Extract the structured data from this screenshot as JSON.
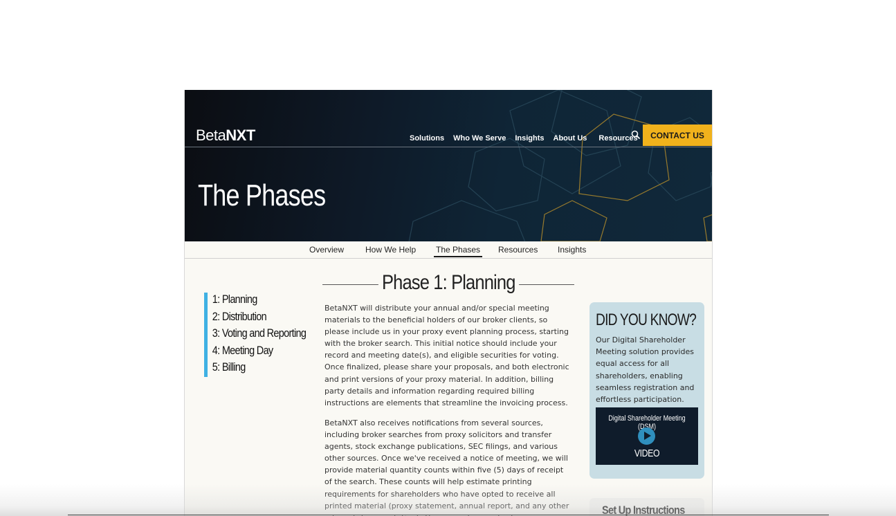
{
  "header": {
    "logo_light": "Beta",
    "logo_bold": "NXT",
    "nav": [
      "Solutions",
      "Who We Serve",
      "Insights",
      "About Us",
      "Resources"
    ],
    "search_icon": "search-icon",
    "contact_label": "CONTACT US",
    "colors": {
      "contact_bg": "#f1b21c",
      "hero_bg": "#0f2536",
      "accent_line": "#3fb1e3"
    }
  },
  "hero": {
    "title": "The Phases"
  },
  "subnav": {
    "items": [
      "Overview",
      "How We Help",
      "The Phases",
      "Resources",
      "Insights"
    ],
    "active": "The Phases"
  },
  "sidebar": {
    "items": [
      "1: Planning",
      "2: Distribution",
      "3: Voting and Reporting",
      "4: Meeting Day",
      "5: Billing"
    ]
  },
  "main": {
    "heading": "Phase 1: Planning",
    "paragraph1": "BetaNXT will distribute your annual and/or special meeting materials to the beneficial holders of our broker clients, so please include us in your proxy event planning process, starting with the broker search. This initial notice should include your record and meeting date(s), and eligible securities for voting. Once finalized, please share your proposals, and both electronic and print versions of your proxy material. In addition, billing party details and information regarding required billing instructions are elements that streamline the invoicing process.",
    "paragraph2": "BetaNXT also receives notifications from several sources, including broker searches from proxy solicitors and transfer agents, stock exchange publications, SEC filings, and various other sources. Once we've received a notice of meeting, we will provide material quantity counts within five (5) days of receipt of the search. These counts will help estimate printing requirements for shareholders who have opted to receive all printed material (proxy statement, annual report, and any other relevant documentation). These counts can also be"
  },
  "did_you_know": {
    "title": "DID YOU KNOW?",
    "text": "Our Digital Shareholder Meeting solution provides equal access for all shareholders, enabling seamless registration and effortless participation.",
    "video_title": "Digital Shareholder Meeting (DSM)",
    "video_label": "VIDEO",
    "play_icon": "play-icon"
  },
  "setup": {
    "title": "Set Up Instructions"
  }
}
